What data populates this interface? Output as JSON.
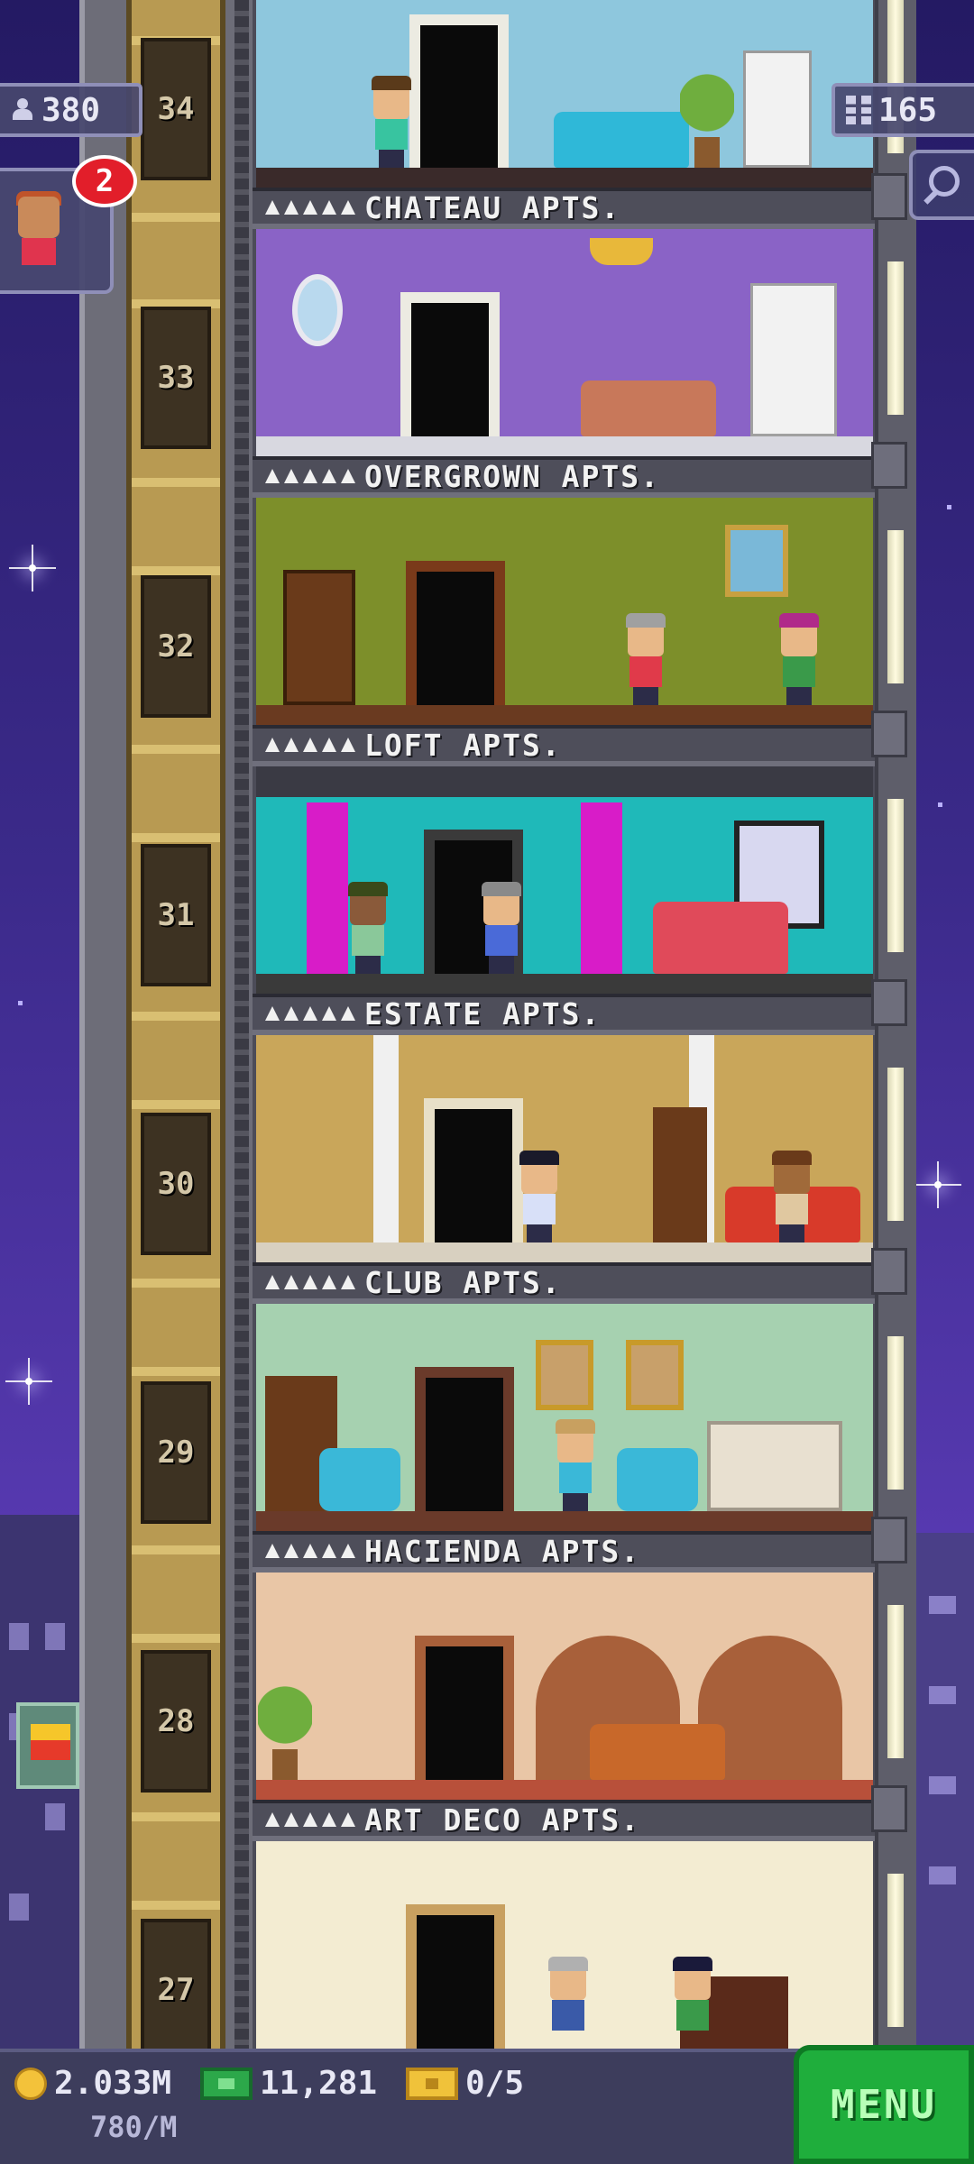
{
  "hud": {
    "population": "380",
    "floor_count": "165",
    "notification_count": "2"
  },
  "floors": [
    {
      "number": "34",
      "name": "CHATEAU APTS.",
      "stars": 5,
      "wall_color": "#8ec7dd"
    },
    {
      "number": "33",
      "name": "OVERGROWN APTS.",
      "stars": 5,
      "wall_color": "#8a63c6"
    },
    {
      "number": "32",
      "name": "LOFT APTS.",
      "stars": 5,
      "wall_color": "#7d8f2a"
    },
    {
      "number": "31",
      "name": "ESTATE APTS.",
      "stars": 5,
      "wall_color": "#1fb9b9"
    },
    {
      "number": "30",
      "name": "CLUB APTS.",
      "stars": 5,
      "wall_color": "#c9a65a"
    },
    {
      "number": "29",
      "name": "HACIENDA APTS.",
      "stars": 5,
      "wall_color": "#a6d1b0"
    },
    {
      "number": "28",
      "name": "ART DECO APTS.",
      "stars": 5,
      "wall_color": "#e9c6a6"
    },
    {
      "number": "27",
      "name": "",
      "stars": 0,
      "wall_color": "#f3ecd2"
    }
  ],
  "bottom_bar": {
    "coins": "2.033M",
    "coin_rate": "780/M",
    "bux": "11,281",
    "tickets": "0/5",
    "menu_label": "MENU"
  },
  "icons": {
    "population": "person-icon",
    "floors": "building-icon",
    "search": "magnifier-icon",
    "coins": "coin-icon",
    "bux": "bux-icon",
    "tickets": "ticket-icon"
  },
  "colors": {
    "menu_button": "#1fae3c",
    "badge": "#e21e2a",
    "sky": "#3b2a8a"
  }
}
